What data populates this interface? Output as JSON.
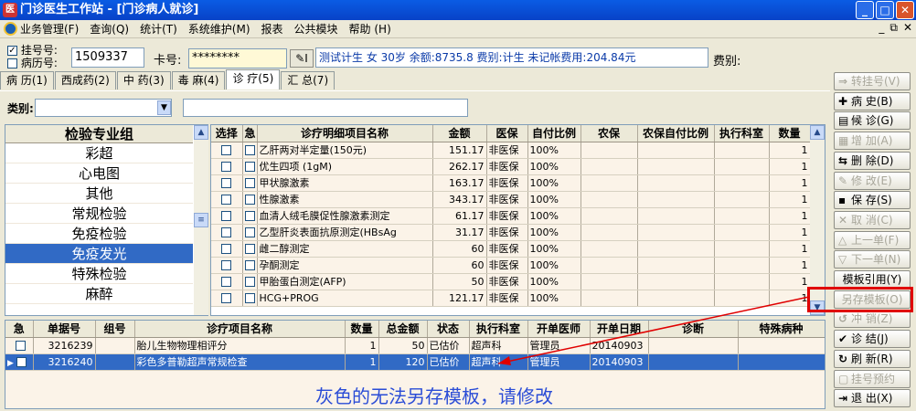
{
  "window": {
    "title": "门诊医生工作站 - [门诊病人就诊]",
    "min": "_",
    "max": "□",
    "close": "✕"
  },
  "menu": {
    "items": [
      "业务管理(F)",
      "查询(Q)",
      "统计(T)",
      "系统维护(M)",
      "报表",
      "公共模块",
      "帮助 (H)"
    ],
    "mdi": [
      "_",
      "⧉",
      "✕"
    ]
  },
  "patient": {
    "chk_reg_label": "挂号号:",
    "chk_rec_label": "病历号:",
    "reg_checked": "✓",
    "reg_no": "1509337",
    "card_label": "卡号:",
    "card_value": "********",
    "info": "测试计生 女 30岁 余额:8735.8 费别:计生 未记帐费用:204.84元",
    "fee_label": "费别:"
  },
  "tabs": [
    "病 历(1)",
    "西成药(2)",
    "中 药(3)",
    "毒 麻(4)",
    "诊 疗(5)",
    "汇 总(7)"
  ],
  "filter": {
    "label": "类别:",
    "value": ""
  },
  "groups": {
    "header": "检验专业组",
    "items": [
      "彩超",
      "心电图",
      "其他",
      "常规检验",
      "免疫检验",
      "免疫发光",
      "特殊检验",
      "麻醉"
    ],
    "selected": "免疫发光"
  },
  "items_grid": {
    "headers": [
      "选择",
      "急",
      "诊疗明细项目名称",
      "金额",
      "医保",
      "自付比例",
      "农保",
      "农保自付比例",
      "执行科室",
      "数量"
    ],
    "rows": [
      [
        "乙肝两对半定量(150元)",
        "151.17",
        "非医保",
        "100%",
        "1"
      ],
      [
        "优生四项 (1gM)",
        "262.17",
        "非医保",
        "100%",
        "1"
      ],
      [
        "甲状腺激素",
        "163.17",
        "非医保",
        "100%",
        "1"
      ],
      [
        "性腺激素",
        "343.17",
        "非医保",
        "100%",
        "1"
      ],
      [
        "血清人绒毛膜促性腺激素测定",
        "61.17",
        "非医保",
        "100%",
        "1"
      ],
      [
        "乙型肝炎表面抗原测定(HBsAg",
        "31.17",
        "非医保",
        "100%",
        "1"
      ],
      [
        "雌二醇测定",
        "60",
        "非医保",
        "100%",
        "1"
      ],
      [
        "孕酮测定",
        "60",
        "非医保",
        "100%",
        "1"
      ],
      [
        "甲胎蛋白测定(AFP)",
        "50",
        "非医保",
        "100%",
        "1"
      ],
      [
        "HCG+PROG",
        "121.17",
        "非医保",
        "100%",
        "1"
      ]
    ]
  },
  "orders_grid": {
    "headers": [
      "急",
      "单据号",
      "组号",
      "诊疗项目名称",
      "数量",
      "总金额",
      "状态",
      "执行科室",
      "开单医师",
      "开单日期",
      "诊断",
      "特殊病种"
    ],
    "rows": [
      [
        "3216239",
        "",
        "胎儿生物物理相评分",
        "1",
        "50",
        "已估价",
        "超声科",
        "管理员",
        "20140903",
        "",
        ""
      ],
      [
        "3216240",
        "",
        "彩色多普勒超声常规检查",
        "1",
        "120",
        "已估价",
        "超声科",
        "管理员",
        "20140903",
        "",
        ""
      ]
    ]
  },
  "buttons": [
    {
      "label": "转挂号(V)",
      "icon": "⇒",
      "enabled": false
    },
    {
      "label": "病 史(B)",
      "icon": "✚",
      "enabled": true
    },
    {
      "label": "候 诊(G)",
      "icon": "▤",
      "enabled": true
    },
    {
      "label": "增 加(A)",
      "icon": "▦",
      "enabled": false
    },
    {
      "label": "删 除(D)",
      "icon": "⇆",
      "enabled": true
    },
    {
      "label": "修 改(E)",
      "icon": "✎",
      "enabled": false
    },
    {
      "label": "保 存(S)",
      "icon": "▪",
      "enabled": true
    },
    {
      "label": "取 消(C)",
      "icon": "✕",
      "enabled": false
    },
    {
      "label": "上一单(F)",
      "icon": "△",
      "enabled": false
    },
    {
      "label": "下一单(N)",
      "icon": "▽",
      "enabled": false
    },
    {
      "label": "模板引用(Y)",
      "icon": "",
      "enabled": true
    },
    {
      "label": "另存模板(O)",
      "icon": "",
      "enabled": false
    },
    {
      "label": "冲 销(Z)",
      "icon": "↺",
      "enabled": false
    },
    {
      "label": "诊 结(J)",
      "icon": "✔",
      "enabled": true
    },
    {
      "label": "刷 新(R)",
      "icon": "↻",
      "enabled": true
    },
    {
      "label": "挂号预约",
      "icon": "▢",
      "enabled": false
    },
    {
      "label": "退 出(X)",
      "icon": "⇥",
      "enabled": true
    }
  ],
  "annotation": {
    "text": "灰色的无法另存模板，请修改",
    "color": "#e00000"
  }
}
